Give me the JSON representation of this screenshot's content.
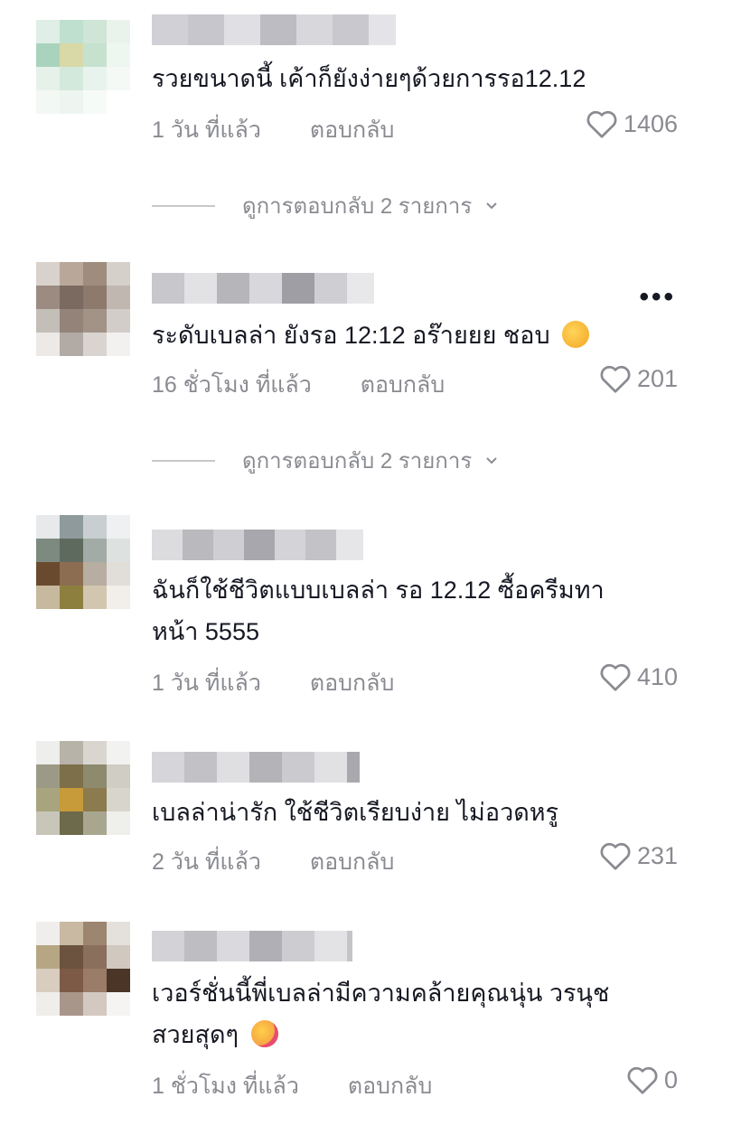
{
  "comments": [
    {
      "text": "รวยขนาดนี้ เค้าก็ยังง่ายๆด้วยการรอ12.12",
      "time": "1 วัน ที่แล้ว",
      "reply": "ตอบกลับ",
      "likes": "1406",
      "view_replies": "ดูการตอบกลับ 2 รายการ"
    },
    {
      "text": "ระดับเบลล่า ยังรอ 12:12 อร๊ายยย ชอบ",
      "emoji": "smiling-face-emoji",
      "time": "16 ชั่วโมง ที่แล้ว",
      "reply": "ตอบกลับ",
      "likes": "201",
      "view_replies": "ดูการตอบกลับ 2 รายการ",
      "more": "•••"
    },
    {
      "text_line1": "ฉันก็ใช้ชีวิตแบบเบลล่า รอ 12.12 ซื้อครีมทา",
      "text_line2": "หน้า 5555",
      "time": "1 วัน ที่แล้ว",
      "reply": "ตอบกลับ",
      "likes": "410"
    },
    {
      "text": "เบลล่าน่ารัก ใช้ชีวิตเรียบง่าย ไม่อวดหรู",
      "time": "2 วัน ที่แล้ว",
      "reply": "ตอบกลับ",
      "likes": "231"
    },
    {
      "text_line1": "เวอร์ชั่นนี้พี่เบลล่ามีความคล้ายคุณนุ่น วรนุช",
      "text_line2": "สวยสุดๆ",
      "emoji": "smiling-face-with-hearts-emoji",
      "time": "1 ชั่วโมง ที่แล้ว",
      "reply": "ตอบกลับ",
      "likes": "0"
    }
  ],
  "colors": {
    "text": "#161823",
    "meta": "#8a8b91"
  },
  "icons": [
    "heart-icon",
    "chevron-down-icon",
    "more-options-icon"
  ]
}
